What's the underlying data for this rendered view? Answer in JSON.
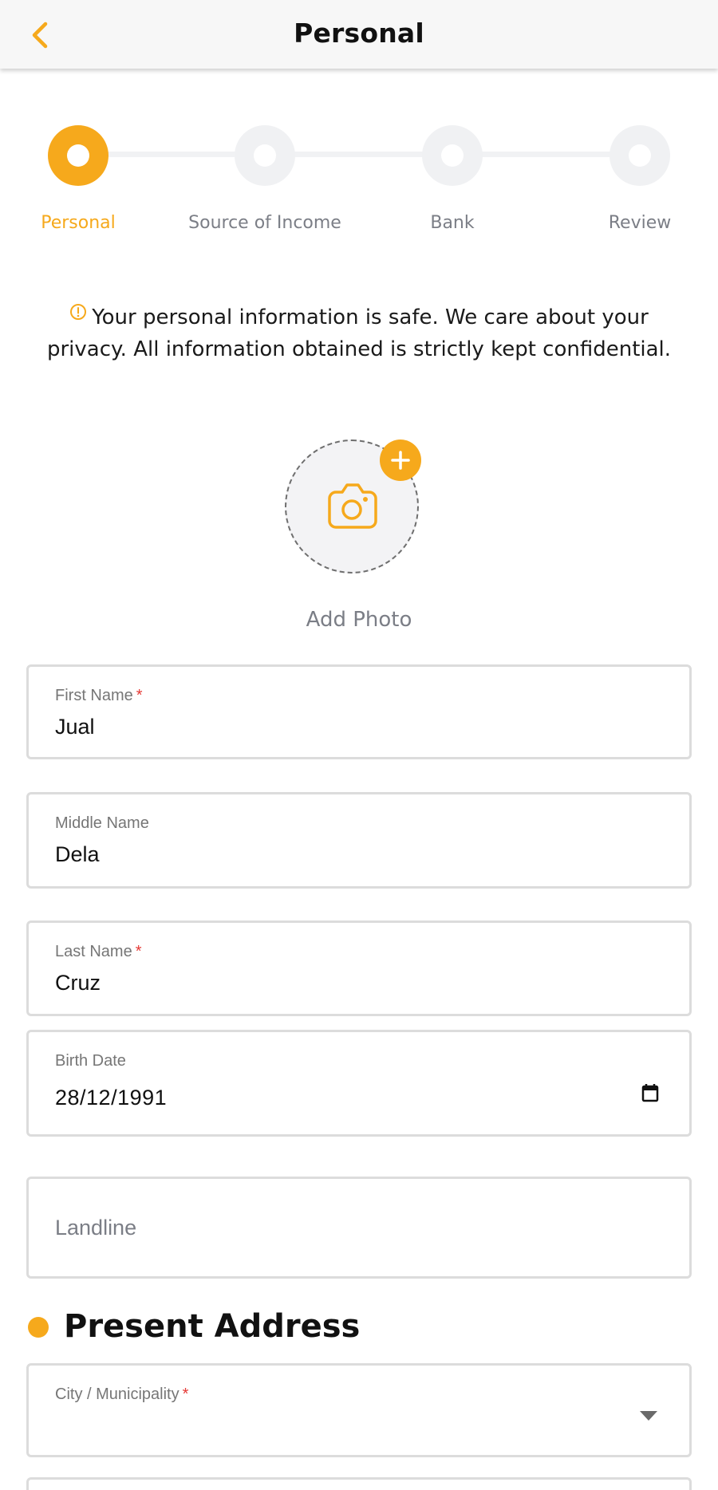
{
  "header": {
    "title": "Personal",
    "back_icon": "chevron-left-icon"
  },
  "colors": {
    "accent": "#f6a91c",
    "required": "#e53935",
    "muted": "#7b7e86"
  },
  "stepper": {
    "steps": [
      {
        "label": "Personal",
        "active": true
      },
      {
        "label": "Source of Income",
        "active": false
      },
      {
        "label": "Bank",
        "active": false
      },
      {
        "label": "Review",
        "active": false
      }
    ]
  },
  "notice": {
    "icon": "info-icon",
    "text": "Your personal information is safe. We care about your privacy. All information obtained is strictly kept confidential."
  },
  "photo": {
    "label": "Add Photo",
    "icon": "camera-icon",
    "badge_icon": "plus-icon"
  },
  "fields": {
    "first_name": {
      "label": "First Name",
      "required": "*",
      "value": "Jual"
    },
    "middle_name": {
      "label": "Middle Name",
      "value": "Dela"
    },
    "last_name": {
      "label": "Last Name",
      "required": "*",
      "value": "Cruz"
    },
    "birth_date": {
      "label": "Birth Date",
      "value": "28/12/1991",
      "icon": "calendar-icon"
    },
    "landline": {
      "placeholder": "Landline"
    }
  },
  "present_address": {
    "title": "Present Address",
    "city": {
      "label": "City / Municipality",
      "required": "*",
      "value": "",
      "icon": "dropdown-arrow-icon"
    }
  }
}
